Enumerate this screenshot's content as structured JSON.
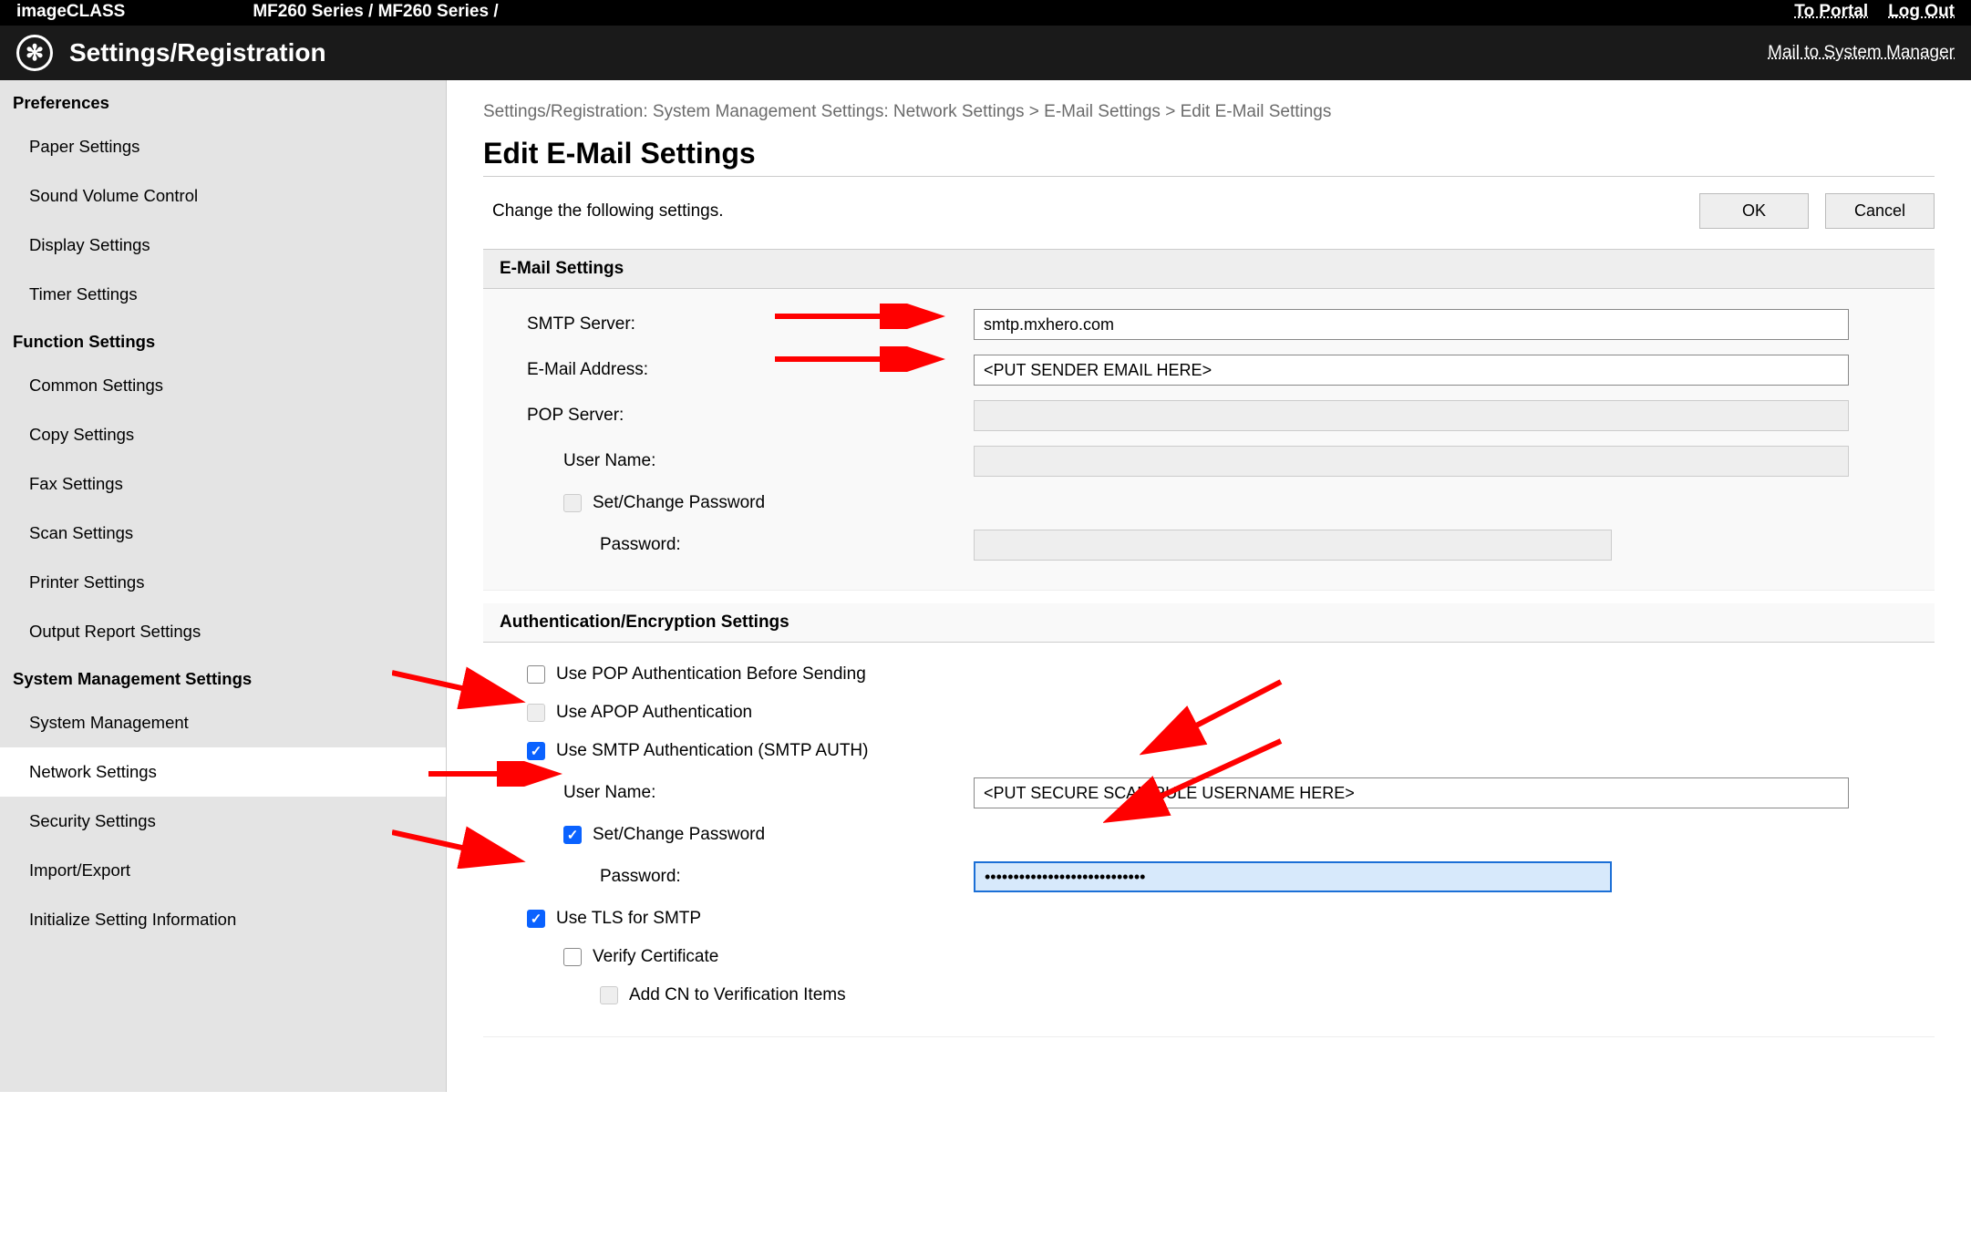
{
  "topbar": {
    "brand": "imageCLASS",
    "model": "MF260 Series / MF260 Series /",
    "to_portal": "To Portal",
    "logout": "Log Out"
  },
  "secondbar": {
    "title": "Settings/Registration",
    "mail_link": "Mail to System Manager"
  },
  "sidebar": {
    "headings": {
      "prefs": "Preferences",
      "func": "Function Settings",
      "sys": "System Management Settings"
    },
    "prefs": [
      "Paper Settings",
      "Sound Volume Control",
      "Display Settings",
      "Timer Settings"
    ],
    "func": [
      "Common Settings",
      "Copy Settings",
      "Fax Settings",
      "Scan Settings",
      "Printer Settings",
      "Output Report Settings"
    ],
    "sys": [
      "System Management",
      "Network Settings",
      "Security Settings",
      "Import/Export",
      "Initialize Setting Information"
    ],
    "active": "Network Settings"
  },
  "breadcrumb": "Settings/Registration: System Management Settings: Network Settings > E-Mail Settings > Edit E-Mail Settings",
  "page_title": "Edit E-Mail Settings",
  "instruction": "Change the following settings.",
  "buttons": {
    "ok": "OK",
    "cancel": "Cancel"
  },
  "email_section": {
    "header": "E-Mail Settings",
    "smtp_label": "SMTP Server:",
    "smtp_value": "smtp.mxhero.com",
    "email_label": "E-Mail Address:",
    "email_value": "<PUT SENDER EMAIL HERE>",
    "pop_label": "POP Server:",
    "pop_value": "",
    "user_label": "User Name:",
    "user_value": "",
    "setpw_label": "Set/Change Password",
    "pw_label": "Password:",
    "pw_value": ""
  },
  "auth_section": {
    "header": "Authentication/Encryption Settings",
    "use_pop": "Use POP Authentication Before Sending",
    "use_apop": "Use APOP Authentication",
    "use_smtp_auth": "Use SMTP Authentication (SMTP AUTH)",
    "user_label": "User Name:",
    "user_value": "<PUT SECURE SCAN RULE USERNAME HERE>",
    "setpw_label": "Set/Change Password",
    "pw_label": "Password:",
    "pw_value": "••••••••••••••••••••••••••••",
    "use_tls": "Use TLS for SMTP",
    "verify_cert": "Verify Certificate",
    "add_cn": "Add CN to Verification Items"
  }
}
